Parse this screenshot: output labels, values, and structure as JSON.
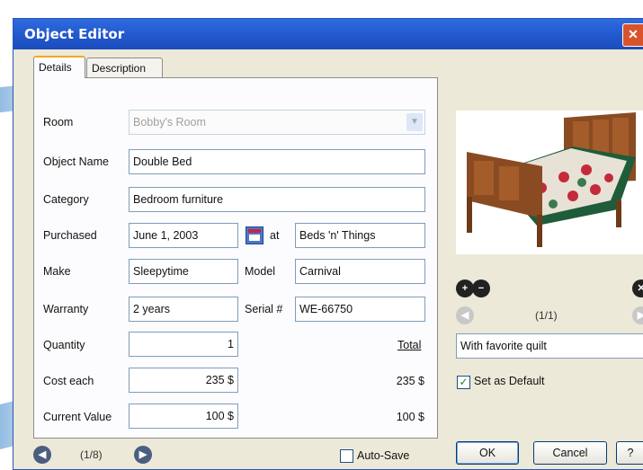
{
  "window": {
    "title": "Object Editor",
    "close_glyph": "✕"
  },
  "tabs": [
    {
      "label": "Details"
    },
    {
      "label": "Description"
    }
  ],
  "form": {
    "room": {
      "label": "Room",
      "value": "Bobby's Room"
    },
    "object_name": {
      "label": "Object Name",
      "value": "Double Bed"
    },
    "category": {
      "label": "Category",
      "value": "Bedroom furniture"
    },
    "purchased": {
      "label": "Purchased",
      "date": "June 1, 2003",
      "at_label": "at",
      "store": "Beds 'n' Things"
    },
    "make": {
      "label": "Make",
      "value": "Sleepytime"
    },
    "model": {
      "label": "Model",
      "value": "Carnival"
    },
    "warranty": {
      "label": "Warranty",
      "value": "2 years"
    },
    "serial": {
      "label": "Serial #",
      "value": "WE-66750"
    },
    "quantity": {
      "label": "Quantity",
      "value": "1"
    },
    "total_header": "Total",
    "cost_each": {
      "label": "Cost each",
      "value": "235 $",
      "total": "235 $"
    },
    "current_value": {
      "label": "Current Value",
      "value": "100 $",
      "total": "100 $"
    }
  },
  "footer": {
    "record_nav": "(1/8)",
    "autosave_label": "Auto-Save",
    "autosave_checked": false,
    "ok_label": "OK",
    "cancel_label": "Cancel",
    "help_label": "?"
  },
  "photo_panel": {
    "nav": "(1/1)",
    "caption": "With favorite quilt",
    "default_label": "Set as Default",
    "default_checked": true
  },
  "colors": {
    "titlebar": "#245bd0",
    "accent_tab": "#f5a623",
    "window_bg": "#ece9d8"
  }
}
